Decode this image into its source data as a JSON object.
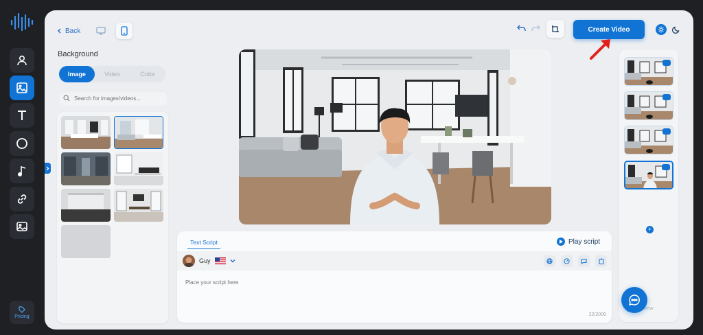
{
  "header": {
    "back_label": "Back",
    "create_label": "Create Video"
  },
  "background_panel": {
    "title": "Background",
    "tabs": [
      {
        "label": "Image",
        "active": true
      },
      {
        "label": "Video",
        "active": false
      },
      {
        "label": "Color",
        "active": false
      }
    ],
    "search_placeholder": "Search for images/videos..."
  },
  "sidebar": {
    "items": [
      {
        "icon": "person-icon"
      },
      {
        "icon": "image-icon",
        "active": true
      },
      {
        "icon": "text-icon"
      },
      {
        "icon": "circle-icon"
      },
      {
        "icon": "music-icon"
      },
      {
        "icon": "link-icon"
      },
      {
        "icon": "media-icon"
      }
    ],
    "pricing_label": "Pricing"
  },
  "script": {
    "tab_label": "Text Script",
    "play_label": "Play script",
    "voice_name": "Guy",
    "placeholder": "Place your script here",
    "counter": "22/2000"
  },
  "scenes": {
    "preview_label": "Preview"
  },
  "colors": {
    "accent": "#1173d4",
    "rail": "#1e2024",
    "panel": "#eceef1"
  }
}
